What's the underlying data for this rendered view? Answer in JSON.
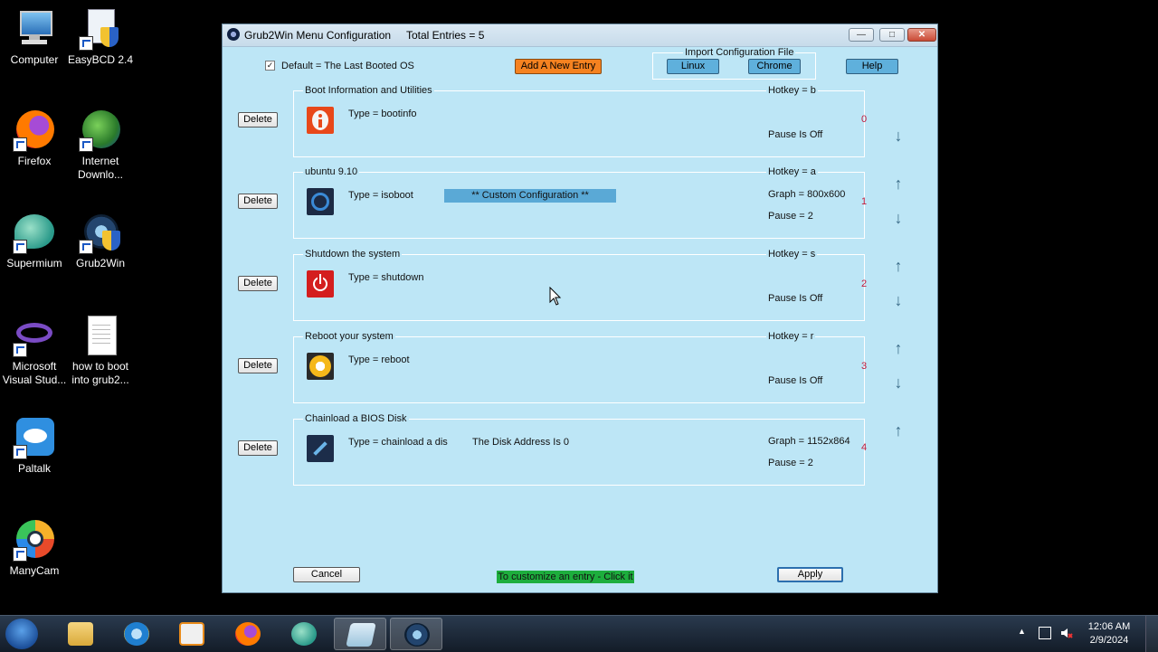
{
  "desktop": {
    "icons": [
      {
        "label": "Computer"
      },
      {
        "label": "EasyBCD 2.4"
      },
      {
        "label": "Firefox"
      },
      {
        "label": "Internet Downlo..."
      },
      {
        "label": "Supermium"
      },
      {
        "label": "Grub2Win"
      },
      {
        "label": "Microsoft Visual Stud..."
      },
      {
        "label": "how to boot into grub2..."
      },
      {
        "label": "Paltalk"
      },
      {
        "label": "ManyCam"
      }
    ]
  },
  "window": {
    "title": "Grub2Win Menu Configuration",
    "entries_count": "Total Entries = 5",
    "buttons": {
      "minimize": "—",
      "maximize": "□",
      "close": "✕"
    }
  },
  "top": {
    "default_checked": "✓",
    "default_label": "Default = The Last Booted OS",
    "add_entry": "Add A New Entry",
    "import_label": "Import Configuration File",
    "linux": "Linux",
    "chrome": "Chrome",
    "help": "Help"
  },
  "entries": [
    {
      "title": "Boot Information and Utilities",
      "hotkey": "Hotkey = b",
      "type": "Type = bootinfo",
      "line1": "",
      "line2": "Pause Is Off",
      "index": "0",
      "delete": "Delete"
    },
    {
      "title": "ubuntu 9.10",
      "hotkey": "Hotkey = a",
      "type": "Type = isoboot",
      "custom": "**  Custom Configuration **",
      "line1": "Graph = 800x600",
      "line2": "Pause = 2",
      "index": "1",
      "delete": "Delete"
    },
    {
      "title": "Shutdown the system",
      "hotkey": "Hotkey = s",
      "type": "Type = shutdown",
      "line1": "",
      "line2": "Pause Is Off",
      "index": "2",
      "delete": "Delete"
    },
    {
      "title": "Reboot your system",
      "hotkey": "Hotkey = r",
      "type": "Type = reboot",
      "line1": "",
      "line2": "Pause Is Off",
      "index": "3",
      "delete": "Delete"
    },
    {
      "title": "Chainload a BIOS Disk",
      "hotkey": "",
      "type": "Type = chainload a dis",
      "disk": "The Disk Address Is 0",
      "line1": "Graph = 1152x864",
      "line2": "Pause = 2",
      "index": "4",
      "delete": "Delete"
    }
  ],
  "arrows": {
    "up": "↑",
    "down": "↓"
  },
  "bottom": {
    "cancel": "Cancel",
    "tip": "To customize an entry - Click it",
    "apply": "Apply"
  },
  "taskbar": {
    "time": "12:06 AM",
    "date": "2/9/2024",
    "tray_up": "▲"
  }
}
